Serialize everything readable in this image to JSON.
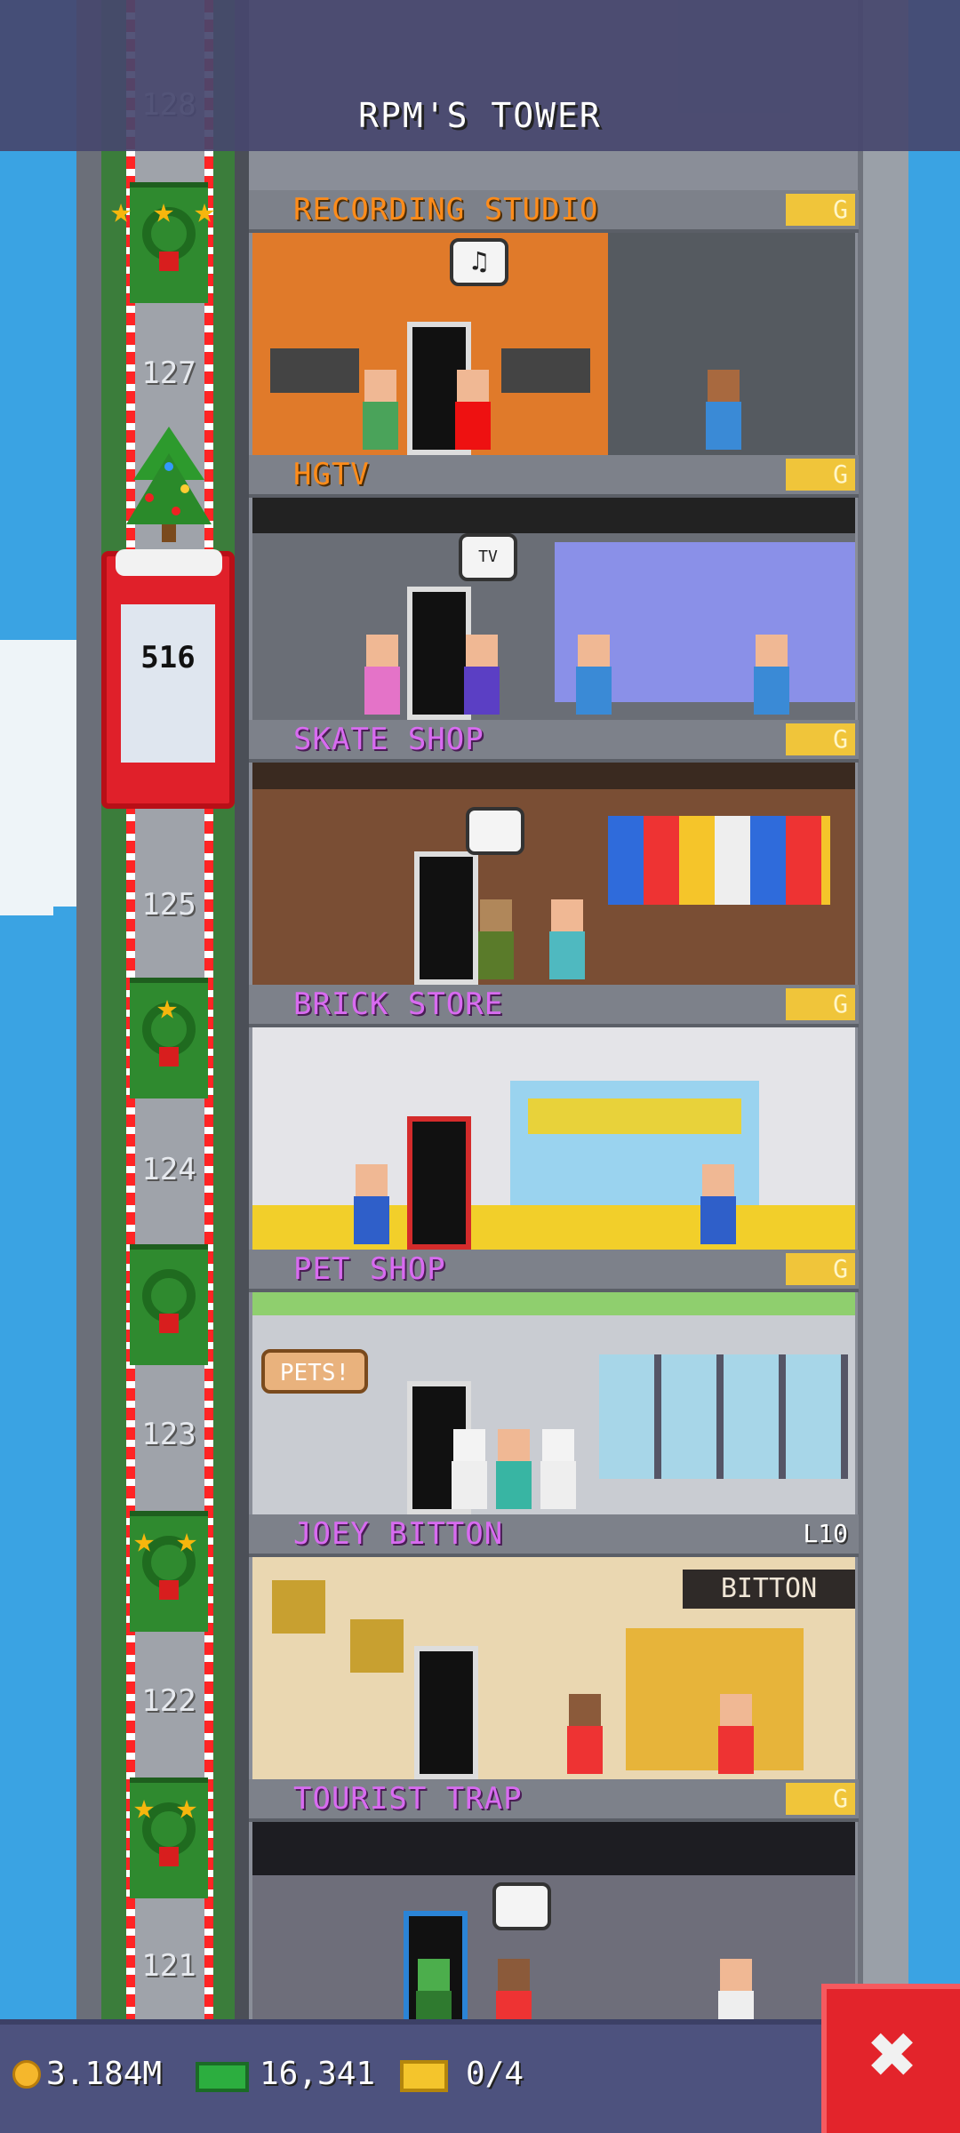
{
  "header": {
    "title": "RPM'S TOWER"
  },
  "elevator": {
    "count": "516"
  },
  "shaft": {
    "floor_numbers": [
      "128",
      "127",
      "125",
      "124",
      "123",
      "122",
      "121"
    ]
  },
  "floors": [
    {
      "name": "RECORDING STUDIO",
      "badge": "G",
      "name_color": "orange",
      "bubble": "♫"
    },
    {
      "name": "HGTV",
      "badge": "G",
      "name_color": "orange",
      "bubble": "TV"
    },
    {
      "name": "SKATE SHOP",
      "badge": "G",
      "name_color": "purple",
      "bubble": ""
    },
    {
      "name": "BRICK STORE",
      "badge": "G",
      "name_color": "purple",
      "bubble": ""
    },
    {
      "name": "PET SHOP",
      "badge": "G",
      "name_color": "purple",
      "sign": "PETS!",
      "bubble": ""
    },
    {
      "name": "JOEY BITTON",
      "badge": "L10",
      "name_color": "purple",
      "sign": "BITTON",
      "bubble": ""
    },
    {
      "name": "TOURIST TRAP",
      "badge": "G",
      "name_color": "purple",
      "bubble": ""
    }
  ],
  "resources": {
    "coins": "3.184M",
    "bux": "16,341",
    "tickets": "0/4"
  },
  "colors": {
    "sky": "#3aa3e3",
    "label_orange": "#ff8c1a",
    "label_purple": "#d86bf0",
    "elevator_red": "#e0202a",
    "close_red": "#e3242b"
  },
  "icons": {
    "close": "close-icon",
    "coin": "coin-icon",
    "bux": "bux-icon",
    "ticket": "ticket-icon"
  }
}
